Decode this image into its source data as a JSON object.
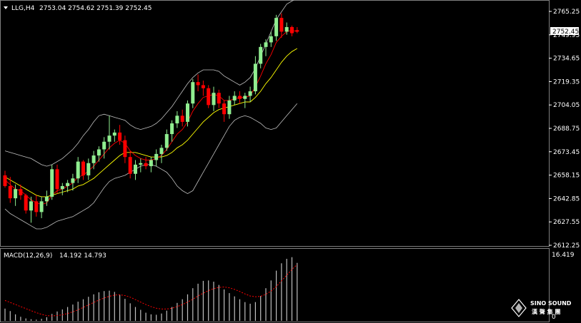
{
  "header": {
    "symbol": "LLG,H4",
    "ohlc": "2753.04 2754.62 2751.39 2752.45"
  },
  "macd_header": {
    "label": "MACD(12,26,9)",
    "values": "14.192 14.793"
  },
  "price_axis": {
    "ticks": [
      "2765.25",
      "2749.95",
      "2734.65",
      "2719.35",
      "2704.05",
      "2688.75",
      "2673.45",
      "2658.15",
      "2642.85",
      "2627.55",
      "2612.25"
    ],
    "current_price_label": "2752.45"
  },
  "macd_axis": {
    "top_label": "16.419",
    "bottom_label": "0"
  },
  "logo": {
    "name": "SINO SOUND",
    "subtitle": "漢 聲 集 團"
  },
  "colors": {
    "bull": "#90EE90",
    "bear": "#FF0000",
    "ma_short": "#FF0000",
    "ma_long": "#FFFF00",
    "bands": "#C0C0C0",
    "macd_hist": "#C0C0C0",
    "macd_signal": "#FF0000",
    "background": "#000000"
  },
  "chart_data": {
    "type": "candlestick",
    "y_range": [
      2612.25,
      2769.0
    ],
    "macd_range": [
      0,
      16.419
    ],
    "candles": [
      [
        2658,
        2661,
        2650,
        2651
      ],
      [
        2651,
        2657,
        2640,
        2643
      ],
      [
        2643,
        2652,
        2638,
        2649
      ],
      [
        2649,
        2652,
        2642,
        2645
      ],
      [
        2645,
        2646,
        2633,
        2635
      ],
      [
        2635,
        2644,
        2627,
        2641
      ],
      [
        2641,
        2645,
        2631,
        2634
      ],
      [
        2634,
        2644,
        2630,
        2641
      ],
      [
        2641,
        2648,
        2638,
        2644
      ],
      [
        2644,
        2665,
        2642,
        2662
      ],
      [
        2662,
        2665,
        2646,
        2649
      ],
      [
        2649,
        2653,
        2645,
        2651
      ],
      [
        2651,
        2655,
        2647,
        2653
      ],
      [
        2653,
        2659,
        2648,
        2656
      ],
      [
        2656,
        2670,
        2653,
        2667
      ],
      [
        2667,
        2668,
        2655,
        2658
      ],
      [
        2658,
        2669,
        2655,
        2666
      ],
      [
        2666,
        2674,
        2662,
        2671
      ],
      [
        2671,
        2677,
        2667,
        2675
      ],
      [
        2675,
        2683,
        2669,
        2680
      ],
      [
        2680,
        2697,
        2675,
        2684
      ],
      [
        2684,
        2688,
        2680,
        2686
      ],
      [
        2686,
        2691,
        2678,
        2681
      ],
      [
        2681,
        2684,
        2666,
        2670
      ],
      [
        2670,
        2674,
        2656,
        2659
      ],
      [
        2659,
        2668,
        2655,
        2665
      ],
      [
        2665,
        2669,
        2660,
        2666
      ],
      [
        2666,
        2670,
        2662,
        2664
      ],
      [
        2664,
        2670,
        2660,
        2668
      ],
      [
        2668,
        2675,
        2664,
        2672
      ],
      [
        2672,
        2678,
        2666,
        2676
      ],
      [
        2676,
        2688,
        2674,
        2685
      ],
      [
        2685,
        2694,
        2680,
        2692
      ],
      [
        2692,
        2700,
        2689,
        2697
      ],
      [
        2697,
        2701,
        2690,
        2693
      ],
      [
        2693,
        2707,
        2690,
        2705
      ],
      [
        2705,
        2721,
        2702,
        2719
      ],
      [
        2719,
        2724,
        2713,
        2717
      ],
      [
        2717,
        2720,
        2710,
        2715
      ],
      [
        2715,
        2717,
        2702,
        2704
      ],
      [
        2704,
        2716,
        2700,
        2712
      ],
      [
        2712,
        2714,
        2702,
        2705
      ],
      [
        2705,
        2707,
        2693,
        2698
      ],
      [
        2698,
        2710,
        2695,
        2707
      ],
      [
        2707,
        2713,
        2704,
        2710
      ],
      [
        2710,
        2713,
        2705,
        2708
      ],
      [
        2708,
        2712,
        2702,
        2710
      ],
      [
        2710,
        2716,
        2706,
        2713
      ],
      [
        2713,
        2736,
        2711,
        2731
      ],
      [
        2731,
        2744,
        2728,
        2742
      ],
      [
        2742,
        2747,
        2736,
        2745
      ],
      [
        2745,
        2752,
        2742,
        2749
      ],
      [
        2749,
        2763,
        2746,
        2761
      ],
      [
        2761,
        2764,
        2748,
        2752
      ],
      [
        2752,
        2758,
        2750,
        2755
      ],
      [
        2755,
        2756,
        2749,
        2751
      ],
      [
        2753,
        2755,
        2751,
        2752
      ]
    ],
    "ma_short": [
      2655,
      2652,
      2649,
      2648,
      2645,
      2642,
      2640,
      2639,
      2640,
      2645,
      2648,
      2649,
      2651,
      2653,
      2657,
      2658,
      2661,
      2664,
      2668,
      2672,
      2676,
      2679,
      2681,
      2679,
      2674,
      2671,
      2669,
      2668,
      2668,
      2669,
      2671,
      2675,
      2680,
      2685,
      2688,
      2693,
      2700,
      2705,
      2709,
      2710,
      2711,
      2710,
      2707,
      2707,
      2708,
      2709,
      2709,
      2710,
      2716,
      2723,
      2731,
      2737,
      2745,
      2749,
      2752,
      2753,
      2752
    ],
    "ma_long": [
      2657,
      2655,
      2653,
      2651,
      2649,
      2647,
      2645,
      2644,
      2644,
      2645,
      2646,
      2647,
      2648,
      2649,
      2651,
      2652,
      2654,
      2656,
      2659,
      2662,
      2665,
      2668,
      2671,
      2673,
      2673,
      2673,
      2672,
      2671,
      2670,
      2670,
      2670,
      2671,
      2673,
      2676,
      2678,
      2681,
      2685,
      2689,
      2693,
      2696,
      2699,
      2701,
      2702,
      2703,
      2704,
      2705,
      2706,
      2706,
      2709,
      2713,
      2718,
      2722,
      2727,
      2732,
      2736,
      2739,
      2741
    ],
    "bb_upper": [
      2674,
      2673,
      2672,
      2671,
      2670,
      2669,
      2667,
      2665,
      2664,
      2665,
      2667,
      2669,
      2672,
      2675,
      2679,
      2684,
      2688,
      2693,
      2697,
      2698,
      2697,
      2696,
      2695,
      2694,
      2691,
      2689,
      2688,
      2689,
      2690,
      2692,
      2695,
      2699,
      2703,
      2708,
      2713,
      2718,
      2722,
      2725,
      2727,
      2727,
      2727,
      2726,
      2723,
      2721,
      2719,
      2717,
      2719,
      2722,
      2728,
      2736,
      2744,
      2752,
      2760,
      2765,
      2770,
      2772,
      2774
    ],
    "bb_lower": [
      2636,
      2633,
      2631,
      2629,
      2627,
      2625,
      2623,
      2623,
      2624,
      2626,
      2628,
      2629,
      2630,
      2631,
      2633,
      2635,
      2637,
      2640,
      2645,
      2650,
      2654,
      2656,
      2657,
      2658,
      2660,
      2662,
      2664,
      2665,
      2665,
      2664,
      2662,
      2660,
      2656,
      2651,
      2648,
      2646,
      2648,
      2654,
      2660,
      2666,
      2672,
      2678,
      2684,
      2690,
      2694,
      2696,
      2697,
      2696,
      2694,
      2692,
      2689,
      2688,
      2689,
      2693,
      2697,
      2701,
      2705
    ],
    "macd_hist": [
      3.0,
      2.4,
      1.6,
      1.0,
      0.6,
      0.4,
      0.3,
      0.5,
      0.9,
      1.7,
      2.3,
      2.8,
      3.4,
      4.0,
      4.7,
      5.3,
      5.9,
      6.5,
      7.0,
      7.3,
      7.4,
      7.1,
      6.4,
      5.4,
      4.3,
      3.4,
      2.7,
      2.0,
      1.6,
      1.5,
      1.8,
      2.5,
      3.4,
      4.4,
      5.3,
      6.5,
      8.0,
      9.1,
      9.8,
      9.9,
      9.6,
      8.8,
      7.7,
      6.8,
      6.0,
      5.3,
      4.6,
      4.2,
      4.6,
      6.1,
      8.0,
      9.9,
      12.3,
      14.1,
      15.2,
      15.6,
      14.2
    ],
    "macd_signal": [
      5.0,
      4.5,
      4.0,
      3.5,
      3.0,
      2.5,
      2.0,
      1.6,
      1.3,
      1.2,
      1.3,
      1.5,
      1.8,
      2.2,
      2.7,
      3.3,
      3.9,
      4.5,
      5.1,
      5.6,
      6.0,
      6.3,
      6.4,
      6.2,
      5.8,
      5.2,
      4.6,
      4.0,
      3.5,
      3.1,
      2.9,
      2.9,
      3.1,
      3.5,
      4.0,
      4.6,
      5.3,
      6.1,
      6.8,
      7.4,
      7.9,
      8.2,
      8.3,
      8.1,
      7.7,
      7.2,
      6.6,
      6.1,
      5.9,
      6.0,
      6.5,
      7.3,
      8.4,
      9.8,
      11.2,
      12.6,
      13.8
    ]
  }
}
